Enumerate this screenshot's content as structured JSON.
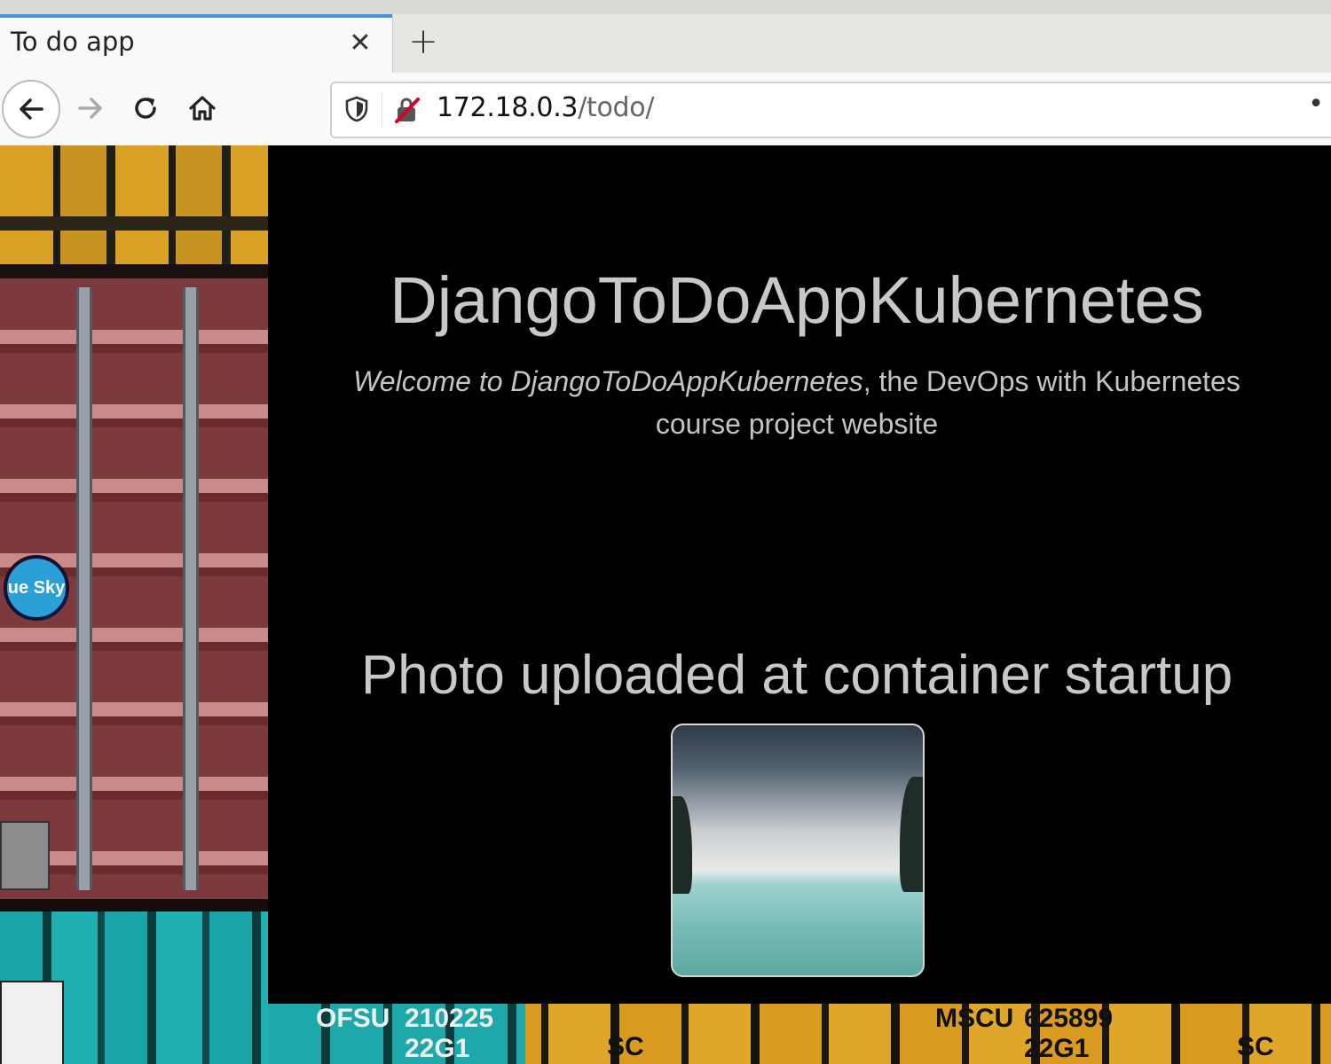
{
  "browser": {
    "tab_title": "To do app",
    "tab_close_glyph": "✕",
    "new_tab_glyph": "+",
    "url_host": "172.18.0.3",
    "url_path": "/todo/",
    "url_more_glyph": "•"
  },
  "page": {
    "title": "DjangoToDoAppKubernetes",
    "welcome_italic": "Welcome to DjangoToDoAppKubernetes",
    "welcome_rest": ", the DevOps with Kubernetes course project website",
    "photo_heading": "Photo uploaded at container startup"
  },
  "background_image": {
    "badge_text": "ue Sky",
    "bottom_labels": [
      "OFSU",
      "210225",
      "22G1",
      "SC",
      "MSCU",
      "625899",
      "22G1",
      "SC"
    ]
  },
  "colors": {
    "page_bg": "#000000",
    "title_text": "#c8c8c8",
    "tab_accent": "#4a90e2",
    "insecure_icon": "#d70022"
  },
  "icons": {
    "back": "back-arrow-icon",
    "forward": "forward-arrow-icon",
    "reload": "reload-icon",
    "home": "home-icon",
    "shield": "shield-icon",
    "insecure": "insecure-connection-icon"
  }
}
